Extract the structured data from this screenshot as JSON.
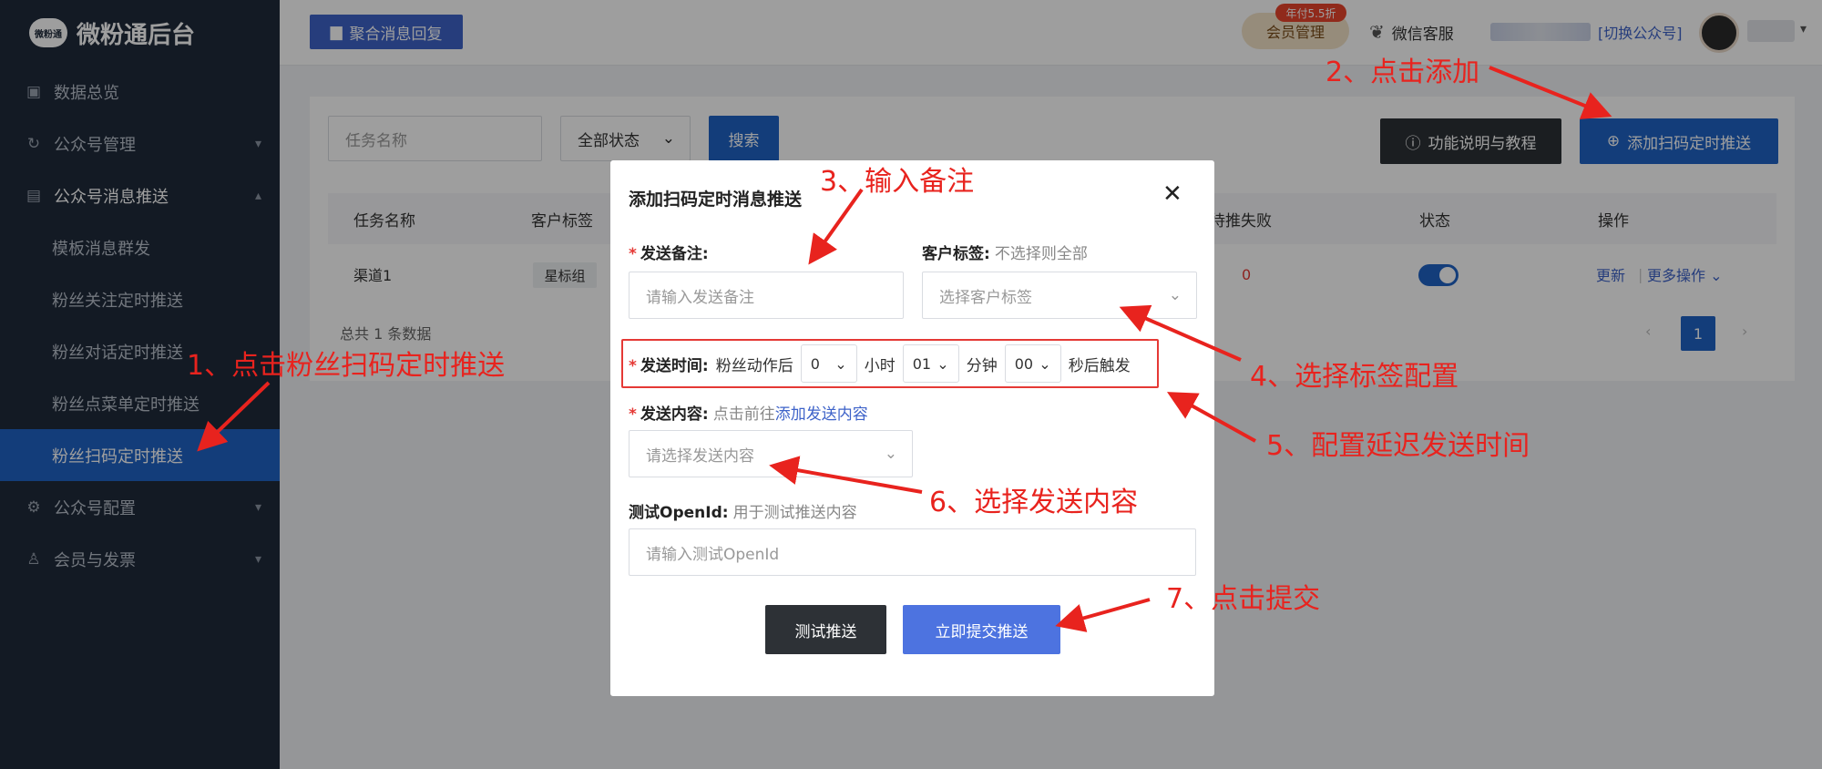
{
  "app": {
    "logo_text": "微粉通后台",
    "logo_mark": "微粉通"
  },
  "sidebar": {
    "items": [
      {
        "label": "数据总览",
        "icon": "chart-icon"
      },
      {
        "label": "公众号管理",
        "icon": "cycle-icon",
        "chevron": "⌄"
      },
      {
        "label": "公众号消息推送",
        "icon": "message-icon",
        "chevron": "⌃"
      },
      {
        "label": "模板消息群发"
      },
      {
        "label": "粉丝关注定时推送"
      },
      {
        "label": "粉丝对话定时推送"
      },
      {
        "label": "粉丝点菜单定时推送"
      },
      {
        "label": "粉丝扫码定时推送"
      },
      {
        "label": "公众号配置",
        "icon": "settings-icon",
        "chevron": "⌄"
      },
      {
        "label": "会员与发票",
        "icon": "user-icon",
        "chevron": "⌄"
      }
    ]
  },
  "topbar": {
    "merge_button": "聚合消息回复",
    "vip_label": "会员管理",
    "vip_tag": "年付5.5折",
    "wechat_service": "微信客服",
    "switch_account": "[切换公众号]"
  },
  "filters": {
    "task_name_placeholder": "任务名称",
    "status_value": "全部状态",
    "search_button": "搜索",
    "help_button": "功能说明与教程",
    "add_button": "添加扫码定时推送"
  },
  "table": {
    "headers": [
      "任务名称",
      "客户标签",
      "待推失败",
      "状态",
      "操作"
    ],
    "row": {
      "name": "渠道1",
      "tag": "星标组",
      "failed": "0",
      "status_on": true,
      "update": "更新",
      "more": "更多操作 ⌄"
    },
    "total": "总共 1 条数据",
    "page": "1"
  },
  "modal": {
    "title": "添加扫码定时消息推送",
    "note_label": "发送备注:",
    "note_placeholder": "请输入发送备注",
    "tag_label": "客户标签:",
    "tag_hint": "不选择则全部",
    "tag_placeholder": "选择客户标签",
    "time_label": "发送时间:",
    "time_prefix": "粉丝动作后",
    "hours": "0",
    "hours_unit": "小时",
    "minutes": "01",
    "minutes_unit": "分钟",
    "seconds": "00",
    "seconds_unit": "秒后触发",
    "content_label": "发送内容:",
    "content_hint": "点击前往",
    "content_link": "添加发送内容",
    "content_placeholder": "请选择发送内容",
    "openid_label": "测试OpenId:",
    "openid_hint": "用于测试推送内容",
    "openid_placeholder": "请输入测试OpenId",
    "test_button": "测试推送",
    "submit_button": "立即提交推送"
  },
  "annotations": {
    "step1": "1、点击粉丝扫码定时推送",
    "step2": "2、点击添加",
    "step3": "3、输入备注",
    "step4": "4、选择标签配置",
    "step5": "5、配置延迟发送时间",
    "step6": "6、选择发送内容",
    "step7": "7、点击提交"
  },
  "colors": {
    "accent": "#1f63c6",
    "sidebar": "#1f2a3a",
    "annotation": "#e8231e"
  }
}
